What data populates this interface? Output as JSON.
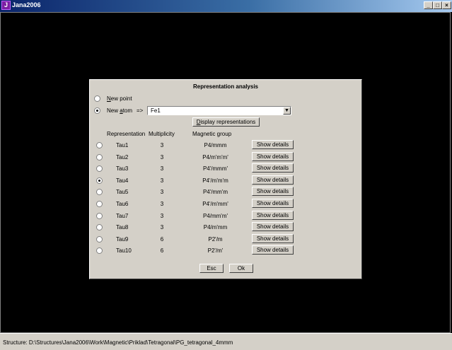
{
  "window": {
    "title": "Jana2006",
    "icon_letter": "J",
    "minimize": "_",
    "maximize": "□",
    "close": "×"
  },
  "dialog": {
    "title": "Representation analysis",
    "new_point": {
      "u": "N",
      "rest": "ew point"
    },
    "new_atom": {
      "pre": "New ",
      "u": "a",
      "rest": "tom",
      "arrow": "=>"
    },
    "atom_value": "Fe1",
    "display_button": {
      "u": "D",
      "rest": "isplay representations"
    },
    "headers": {
      "representation": "Representation",
      "multiplicity": "Multiplicity",
      "magnetic_group": "Magnetic group"
    },
    "rows": [
      {
        "rep": "Tau1",
        "mult": "3",
        "group": "P4/mmm",
        "details": "Show details",
        "selected": false
      },
      {
        "rep": "Tau2",
        "mult": "3",
        "group": "P4/m'm'm'",
        "details": "Show details",
        "selected": false
      },
      {
        "rep": "Tau3",
        "mult": "3",
        "group": "P4'/mmm'",
        "details": "Show details",
        "selected": false
      },
      {
        "rep": "Tau4",
        "mult": "3",
        "group": "P4'/m'm'm",
        "details": "Show details",
        "selected": true
      },
      {
        "rep": "Tau5",
        "mult": "3",
        "group": "P4'/mm'm",
        "details": "Show details",
        "selected": false
      },
      {
        "rep": "Tau6",
        "mult": "3",
        "group": "P4'/m'mm'",
        "details": "Show details",
        "selected": false
      },
      {
        "rep": "Tau7",
        "mult": "3",
        "group": "P4/mm'm'",
        "details": "Show details",
        "selected": false
      },
      {
        "rep": "Tau8",
        "mult": "3",
        "group": "P4/m'mm",
        "details": "Show details",
        "selected": false
      },
      {
        "rep": "Tau9",
        "mult": "6",
        "group": "P2'/m",
        "details": "Show details",
        "selected": false
      },
      {
        "rep": "Tau10",
        "mult": "6",
        "group": "P2'/m'",
        "details": "Show details",
        "selected": false
      }
    ],
    "esc_label": "Esc",
    "ok_label": "Ok"
  },
  "status": {
    "text": "Structure: D:\\Structures\\Jana2006\\Work\\Magnetic\\Priklad\\Tetragonal\\PG_tetragonal_4mmm"
  }
}
